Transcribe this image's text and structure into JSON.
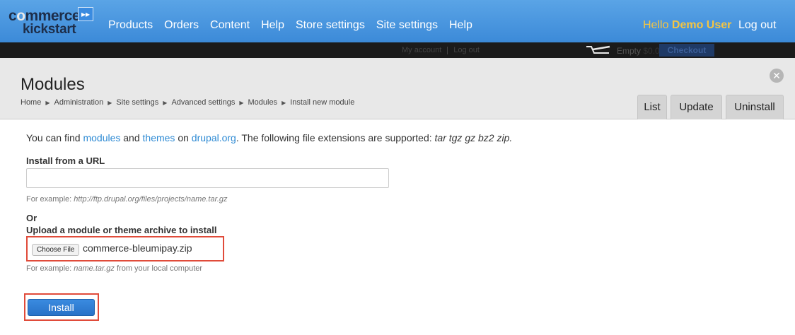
{
  "toolbar": {
    "logo_line1_a": "c",
    "logo_line1_o": "o",
    "logo_line1_b": "mmerce",
    "logo_line2": "kickstart",
    "logo_arrows": "▸▸",
    "menu": [
      "Products",
      "Orders",
      "Content",
      "Help",
      "Store settings",
      "Site settings",
      "Help"
    ],
    "hello_prefix": "Hello ",
    "user_name": "Demo User",
    "logout": "Log out"
  },
  "account_bar": {
    "my_account": "My account",
    "log_out": "Log out",
    "cart_status": "Empty",
    "cart_amount": "$0.00",
    "checkout": "Checkout"
  },
  "overlay": {
    "title": "Modules",
    "close_icon": "close-icon",
    "breadcrumb": [
      "Home",
      "Administration",
      "Site settings",
      "Advanced settings",
      "Modules",
      "Install new module"
    ],
    "tabs": [
      "List",
      "Update",
      "Uninstall"
    ]
  },
  "content": {
    "intro_prefix": "You can find ",
    "intro_modules_link": "modules",
    "intro_and": " and ",
    "intro_themes_link": "themes",
    "intro_on": " on ",
    "intro_drupal_link": "drupal.org",
    "intro_suffix": ". The following file extensions are supported: ",
    "extensions": "tar tgz gz bz2 zip.",
    "url_label": "Install from a URL",
    "url_value": "",
    "url_hint_prefix": "For example: ",
    "url_hint_example": "http://ftp.drupal.org/files/projects/name.tar.gz",
    "or_label": "Or",
    "upload_label": "Upload a module or theme archive to install",
    "choose_file": "Choose File",
    "file_name": "commerce-bleumipay.zip",
    "upload_hint_prefix": "For example: ",
    "upload_hint_example": "name.tar.gz",
    "upload_hint_suffix": " from your local computer",
    "install_button": "Install"
  },
  "colors": {
    "toolbar_blue": "#3c8ad8",
    "link_blue": "#2f8bd4",
    "highlight_red": "#e04b3a",
    "user_yellow": "#f5c542"
  }
}
